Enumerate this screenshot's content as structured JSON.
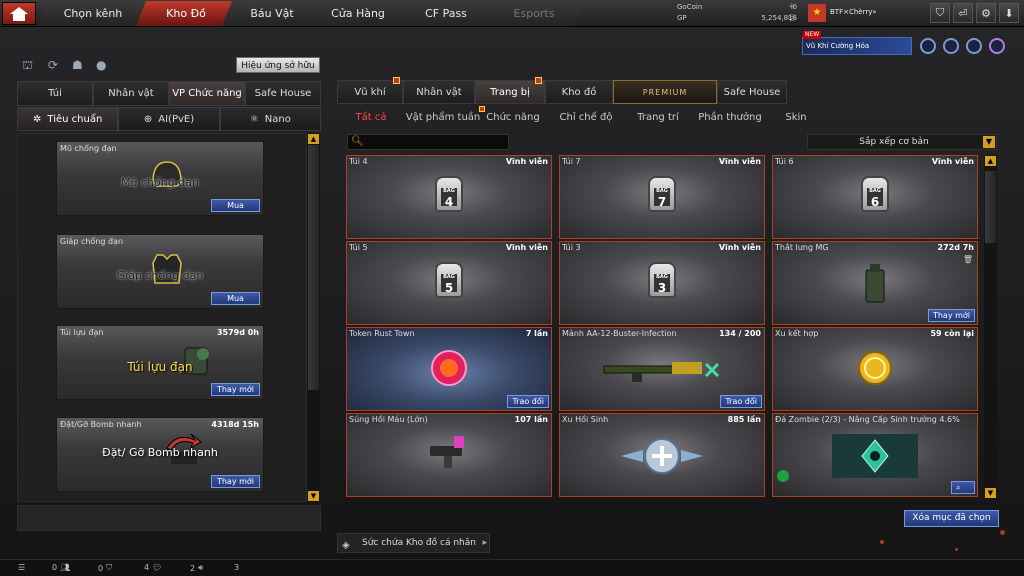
{
  "nav": {
    "tabs": [
      {
        "label": "Chọn kênh",
        "state": "normal"
      },
      {
        "label": "Kho Đồ",
        "state": "active"
      },
      {
        "label": "Báu Vật",
        "state": "normal"
      },
      {
        "label": "Cửa Hàng",
        "state": "normal"
      },
      {
        "label": "CF Pass",
        "state": "normal"
      },
      {
        "label": "Esports",
        "state": "disabled"
      }
    ]
  },
  "currency": {
    "gocoin_label": "GoCoin",
    "gocoin_value": "0",
    "gp_label": "GP",
    "gp_value": "5,254,816"
  },
  "user": {
    "name": "BTF×Chèrry»",
    "flag_icon": "vietnam-flag-icon"
  },
  "promo": {
    "badge": "NEW",
    "label": "Vũ Khí Cường Hóa"
  },
  "left": {
    "effects_button": "Hiệu ứng sở hữu",
    "tabs": [
      "Túi",
      "Nhân vật",
      "VP Chức năng",
      "Safe House"
    ],
    "active_tab": "VP Chức năng",
    "subtabs": [
      "Tiêu chuẩn",
      "AI(PvE)",
      "Nano"
    ],
    "active_subtab": "Tiêu chuẩn",
    "items": [
      {
        "title": "Mũ chống đạn",
        "art_text": "Mũ chống đạn",
        "duration": "",
        "action": "Mua"
      },
      {
        "title": "Giáp chống đạn",
        "art_text": "Giáp chống đạn",
        "duration": "",
        "action": "Mua"
      },
      {
        "title": "Túi lựu đạn",
        "art_text": "Túi lựu đạn",
        "duration": "3579d 0h",
        "action": "Thay mới"
      },
      {
        "title": "Đặt/Gỡ Bomb nhanh",
        "art_text": "Đặt/ Gỡ Bomb nhanh",
        "duration": "4318d 15h",
        "action": "Thay mới"
      }
    ]
  },
  "right": {
    "tabs": [
      "Vũ khí",
      "Nhân vật",
      "Trang bị",
      "Kho đồ",
      "PREMIUM",
      "Safe House"
    ],
    "active_tab": "Trang bị",
    "categories": [
      "Tất cả",
      "Vật phẩm tuần",
      "Chức năng",
      "Chỉ chế độ",
      "Trang trí",
      "Phần thưởng",
      "Skin"
    ],
    "active_category": "Tất cả",
    "sort_label": "Sắp xếp cơ bản",
    "cards": [
      {
        "title": "Túi 4",
        "meta": "Vĩnh viễn",
        "bag": "4",
        "action": ""
      },
      {
        "title": "Túi 7",
        "meta": "Vĩnh viễn",
        "bag": "7",
        "action": ""
      },
      {
        "title": "Túi 6",
        "meta": "Vĩnh viễn",
        "bag": "6",
        "action": ""
      },
      {
        "title": "Túi 5",
        "meta": "Vĩnh viễn",
        "bag": "5",
        "action": ""
      },
      {
        "title": "Túi 3",
        "meta": "Vĩnh viễn",
        "bag": "3",
        "action": ""
      },
      {
        "title": "Thắt lưng MG",
        "meta": "272d 7h",
        "bag": "",
        "action": "Thay mới"
      },
      {
        "title": "Token Rust Town",
        "meta": "7 lần",
        "bag": "",
        "action": "Trao đổi"
      },
      {
        "title": "Mảnh AA-12-Buster-Infection",
        "meta": "134 / 200",
        "bag": "",
        "action": "Trao đổi"
      },
      {
        "title": "Xu kết hợp",
        "meta": "59 còn lại",
        "bag": "",
        "action": ""
      },
      {
        "title": "Súng Hồi Máu (Lớn)",
        "meta": "107 lần",
        "bag": "",
        "action": ""
      },
      {
        "title": "Xu Hồi Sinh",
        "meta": "885 lần",
        "bag": "",
        "action": ""
      },
      {
        "title": "Đá Zombie (2/3) - Nâng Cấp Sinh trưởng 4.6%",
        "meta": "",
        "bag": "",
        "action": ""
      }
    ],
    "clear_button": "Xóa mục đã chọn",
    "capacity_label": "Sức chứa Kho đồ cá nhân"
  },
  "bottom": {
    "counts": [
      "0",
      "0",
      "4",
      "2",
      "3"
    ]
  },
  "colors": {
    "accent_red": "#c0392b",
    "card_border": "#b04020",
    "button_blue": "#2c4890",
    "gold": "#d4a020"
  }
}
